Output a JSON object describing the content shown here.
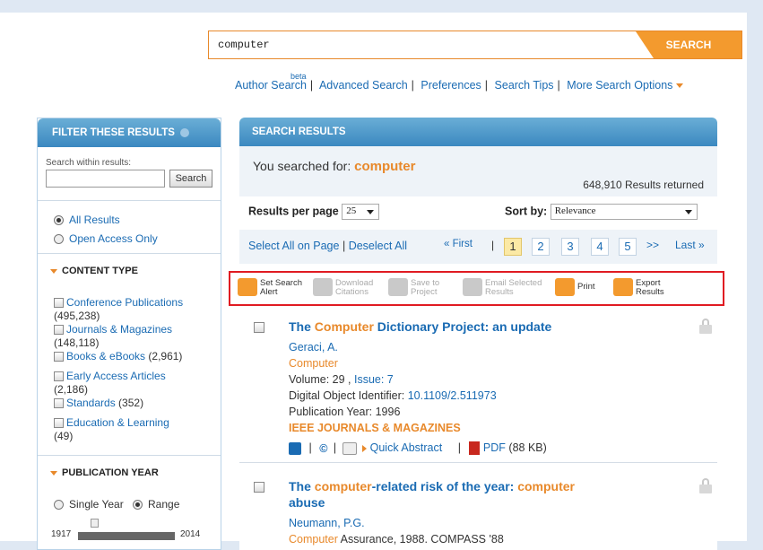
{
  "search": {
    "query": "computer",
    "button": "SEARCH"
  },
  "links": {
    "beta": "beta",
    "items": [
      "Author Search",
      "Advanced Search",
      "Preferences",
      "Search Tips",
      "More Search Options"
    ]
  },
  "filter": {
    "title": "FILTER THESE RESULTS",
    "within_label": "Search within results:",
    "within_button": "Search",
    "access": [
      "All Results",
      "Open Access Only"
    ],
    "content_type_title": "CONTENT TYPE",
    "content_types": [
      {
        "label": "Conference Publications",
        "count": "(495,238)"
      },
      {
        "label": "Journals & Magazines",
        "count": "(148,118)"
      },
      {
        "label": "Books & eBooks",
        "count": "(2,961)"
      },
      {
        "label": "Early Access Articles",
        "count": "(2,186)"
      },
      {
        "label": "Standards",
        "count": "(352)"
      },
      {
        "label": "Education & Learning",
        "count": "(49)"
      }
    ],
    "pub_year_title": "PUBLICATION YEAR",
    "year_modes": [
      "Single Year",
      "Range"
    ],
    "year_min": "1917",
    "year_max": "2014"
  },
  "results": {
    "title": "SEARCH RESULTS",
    "you_searched": "You searched for:",
    "term": "computer",
    "count": "648,910 Results returned",
    "rpp_label": "Results per page",
    "rpp_value": "25",
    "sort_label": "Sort by:",
    "sort_value": "Relevance",
    "select_all": "Select All on Page",
    "deselect_all": "Deselect All",
    "first": "« First",
    "pages": [
      "1",
      "2",
      "3",
      "4",
      "5"
    ],
    "next": ">>",
    "last": "Last »",
    "toolbar": [
      {
        "l1": "Set Search",
        "l2": "Alert"
      },
      {
        "l1": "Download",
        "l2": "Citations"
      },
      {
        "l1": "Save to",
        "l2": "Project"
      },
      {
        "l1": "Email Selected",
        "l2": "Results"
      },
      {
        "l1": "Print",
        "l2": ""
      },
      {
        "l1": "Export",
        "l2": "Results"
      }
    ],
    "items": [
      {
        "title_pre": "The ",
        "title_hl": "Computer",
        "title_post": " Dictionary Project: an update",
        "author": "Geraci, A.",
        "source": "Computer",
        "volume": "Volume: 29 , ",
        "issue": "Issue: 7",
        "doi_label": "Digital Object Identifier: ",
        "doi": "10.1109/2.511973",
        "year": "Publication Year: 1996",
        "pubtype": "IEEE JOURNALS & MAGAZINES",
        "quick_abstract": "Quick Abstract",
        "pdf": "PDF",
        "pdf_size": "(88 KB)"
      },
      {
        "title_pre": "The ",
        "title_hl": "computer",
        "title_mid": "-related risk of the year: ",
        "title_hl2": "computer",
        "title_post": "abuse",
        "author": "Neumann, P.G.",
        "source_hl": "Computer",
        "source_rest": " Assurance, 1988. COMPASS '88"
      }
    ]
  }
}
